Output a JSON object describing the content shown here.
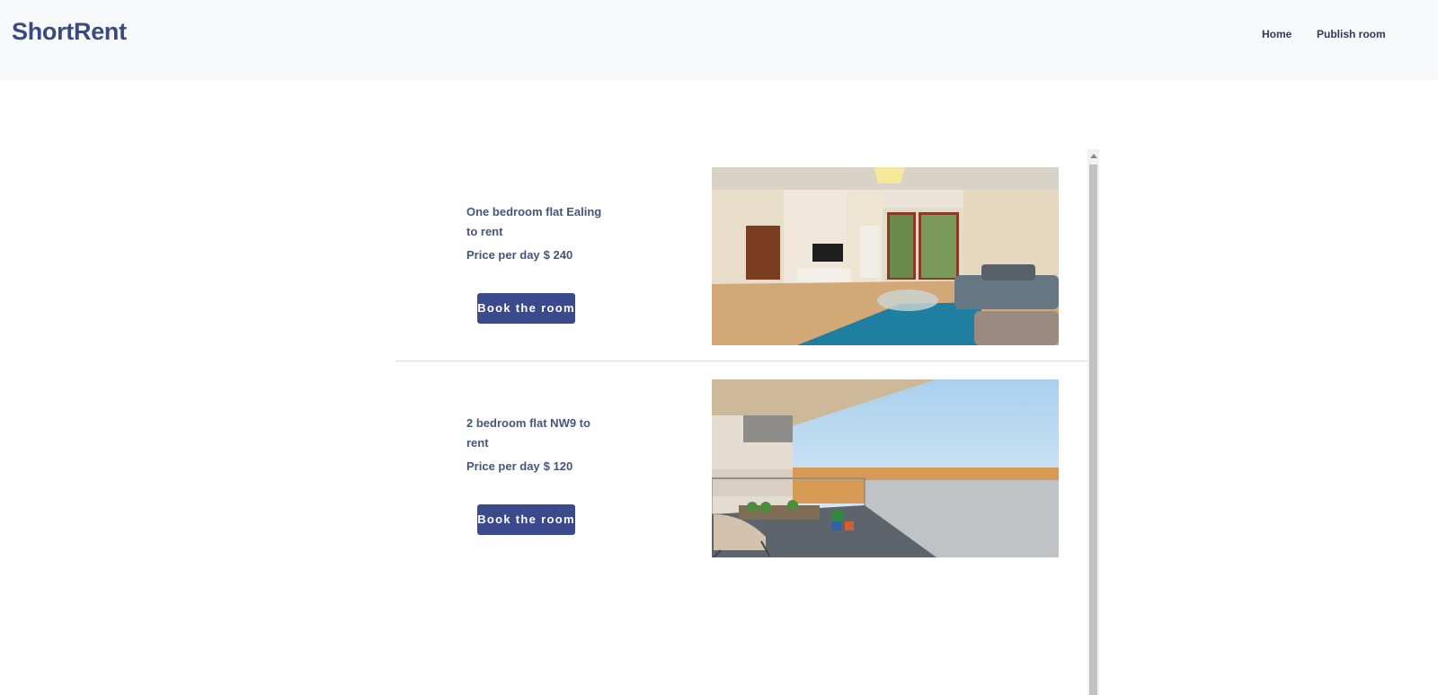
{
  "header": {
    "brand": "ShortRent",
    "nav": [
      {
        "label": "Home"
      },
      {
        "label": "Publish room"
      }
    ]
  },
  "rooms": [
    {
      "title": "One bedroom flat Ealing to rent",
      "price_label": "Price per day",
      "price": "$ 240",
      "button_label": "Book the room",
      "photo": "living-room-photo"
    },
    {
      "title": "2 bedroom flat NW9 to rent",
      "price_label": "Price per day",
      "price": "$ 120",
      "button_label": "Book the room",
      "photo": "balcony-view-photo"
    }
  ],
  "colors": {
    "brand": "#3b4a7d",
    "button": "#3b4a8d",
    "header_bg": "#f8f9fa",
    "text": "#46557a"
  }
}
